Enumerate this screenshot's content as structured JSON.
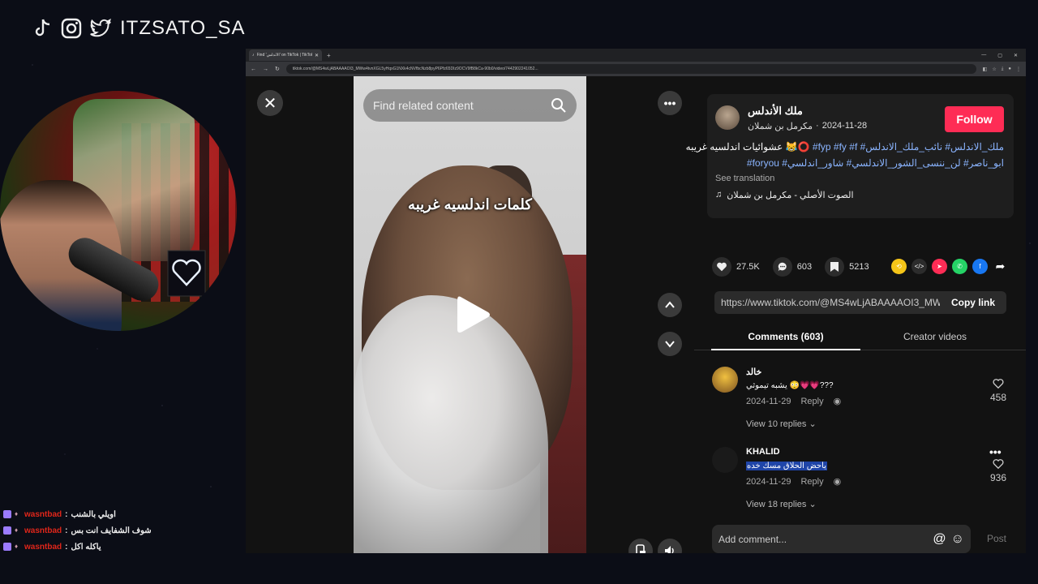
{
  "overlay": {
    "handle": "ITZSATO_SA",
    "socials": [
      "tiktok-icon",
      "instagram-icon",
      "twitter-icon"
    ],
    "chat": [
      {
        "user": "wasntbad",
        "message": "اويلي بالشنب"
      },
      {
        "user": "wasntbad",
        "message": "شوف الشفايف انت بس"
      },
      {
        "user": "wasntbad",
        "message": "ياكله اكل"
      }
    ]
  },
  "browser": {
    "tab_title": "Find 'الأندلس' on TikTok | TikTok",
    "url": "tiktok.com/@MS4wLjABAAAAOI3_MWw4tvnXGL5yHqxG1NXk4cNVfbcNzb8pyP6Pfz65DIz9OCV9fB8kCa-90b0/video/7442902241052..."
  },
  "video": {
    "search_placeholder": "Find related content",
    "overlay_text": "كلمات اندلسيه غريبه"
  },
  "post": {
    "author": "ملك الأندلس",
    "author_sub": "مكرمل بن شملان",
    "date": "2024-11-28",
    "follow_label": "Follow",
    "desc_line1_text": "عشوائيات اندلسيه غريبه 😹⭕",
    "desc_line1_tags": "#fyp #fy #f #ملك_الاندلس# نائب_ملك_الاندلس",
    "desc_line2_tags": "#foryou #ابو_ناصر# لن_ننسى_الشور_الاندلسي# شاور_اندلسي",
    "see_translation": "See translation",
    "sound": "الصوت الأصلي - مكرمل بن شملان",
    "likes": "27.5K",
    "comments": "603",
    "saves": "5213",
    "link": "https://www.tiktok.com/@MS4wLjABAAAAOI3_MWw4t...",
    "copy_link": "Copy link"
  },
  "tabs": {
    "comments": "Comments (603)",
    "creator": "Creator videos"
  },
  "comments": [
    {
      "user": "خالد",
      "text": "يشبه تيموثي 😳💗💗???",
      "date": "2024-11-29",
      "reply": "Reply",
      "likes": "458",
      "replies": "View 10 replies"
    },
    {
      "user": "KHALID",
      "text": "ياحض الحلاق مسك خده",
      "date": "2024-11-29",
      "reply": "Reply",
      "likes": "936",
      "replies": "View 18 replies"
    }
  ],
  "composer": {
    "placeholder": "Add comment...",
    "post": "Post"
  },
  "colors": {
    "follow": "#fe2c55",
    "hashtag": "#8ab4ff",
    "chat_user": "#e0261a"
  }
}
